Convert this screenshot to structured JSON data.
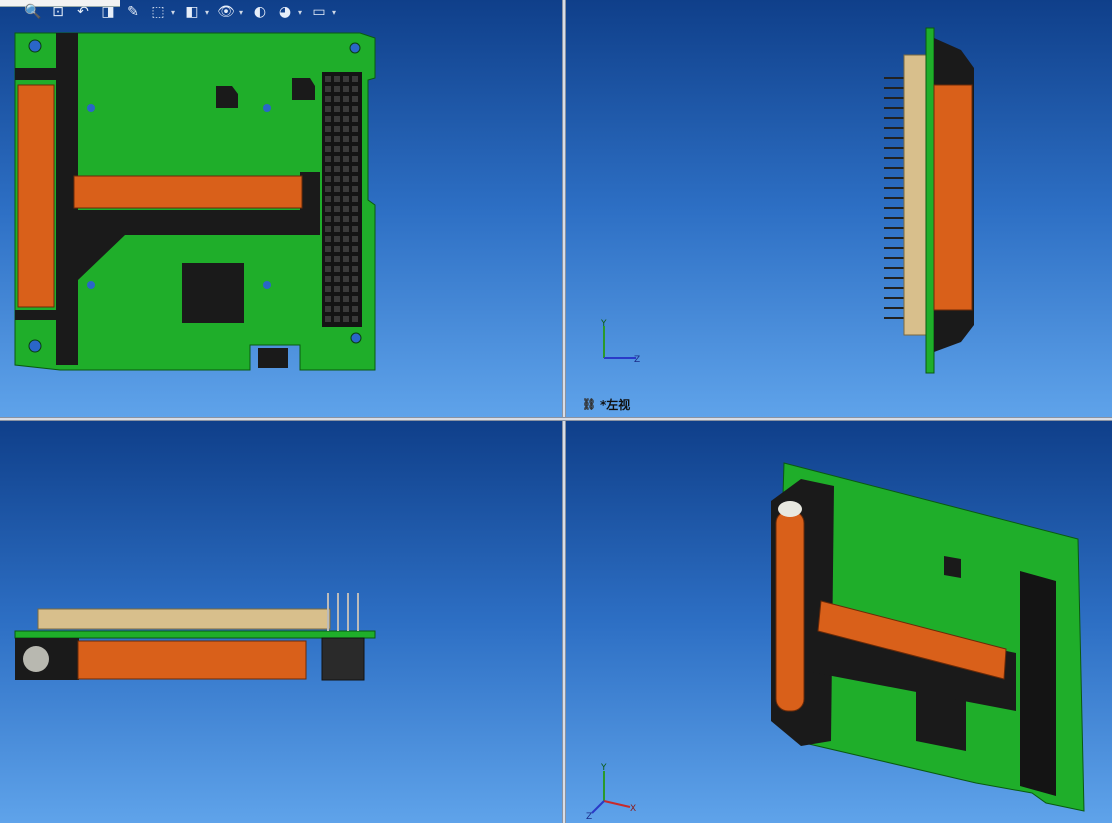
{
  "toolbar": {
    "buttons": [
      {
        "name": "zoom-to-fit",
        "icon": "🔍",
        "dropdown": false
      },
      {
        "name": "zoom-to-area",
        "icon": "⊡",
        "dropdown": false
      },
      {
        "name": "previous-view",
        "icon": "↶",
        "dropdown": false
      },
      {
        "name": "section-view",
        "icon": "◨",
        "dropdown": false
      },
      {
        "name": "dynamic-annotation",
        "icon": "✎",
        "dropdown": false
      },
      {
        "name": "view-orientation",
        "icon": "⬚",
        "dropdown": true
      },
      {
        "name": "display-style",
        "icon": "◧",
        "dropdown": true
      },
      {
        "name": "hide-show-items",
        "icon": "👁",
        "dropdown": true
      },
      {
        "name": "edit-appearance",
        "icon": "◐",
        "dropdown": false
      },
      {
        "name": "apply-scene",
        "icon": "◕",
        "dropdown": true
      },
      {
        "name": "view-settings",
        "icon": "▭",
        "dropdown": true
      }
    ]
  },
  "viewports": {
    "top_left": {
      "name": "front-view",
      "label": ""
    },
    "top_right": {
      "name": "left-view",
      "label": "*左视",
      "triad": {
        "y": "Y",
        "z": "Z"
      }
    },
    "bottom_left": {
      "name": "top-view",
      "label": ""
    },
    "bottom_right": {
      "name": "isometric-view",
      "label": "",
      "triad": {
        "y": "Y",
        "z": "Z",
        "x": "X"
      }
    }
  },
  "colors": {
    "pcb_green": "#1fae2a",
    "component_black": "#1a1a1a",
    "cylinder_orange": "#d9601a",
    "viewport_top": "#0f3f8a",
    "viewport_bottom": "#5fa3ea"
  }
}
